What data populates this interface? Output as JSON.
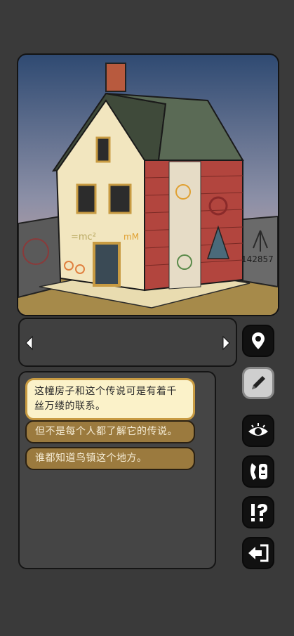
{
  "scene": {
    "graffiti_formula": "=mc²",
    "graffiti_numbers": "142857",
    "graffiti_scribble": "mM"
  },
  "navigation": {
    "prev": "previous",
    "next": "next"
  },
  "dialog": {
    "options": [
      "这幢房子和这个传说可是有着千丝万缕的联系。",
      "但不是每个人都了解它的传说。",
      "谁都知道鸟镇这个地方。"
    ]
  },
  "toolbar": {
    "icons": [
      "location-pin-icon",
      "pencil-icon",
      "eye-icon",
      "phone-face-icon",
      "exclaim-question-icon",
      "exit-icon"
    ]
  }
}
